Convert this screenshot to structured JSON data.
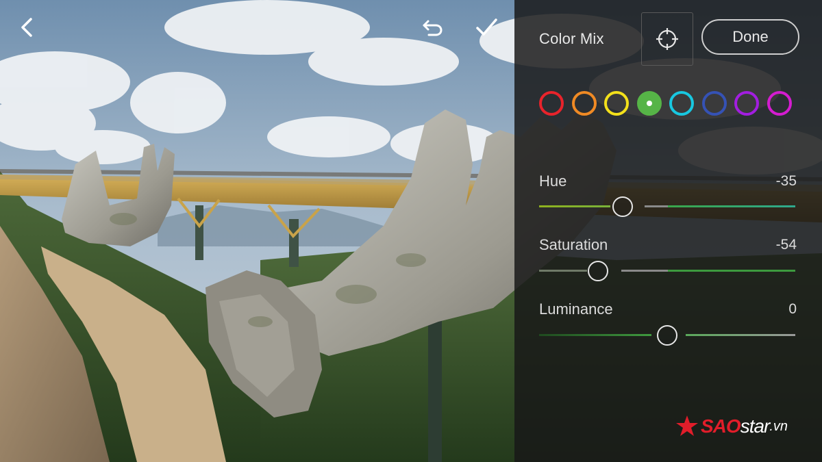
{
  "panel": {
    "title": "Color Mix",
    "done_label": "Done"
  },
  "topbar": {
    "back_icon": "chevron-left-icon",
    "undo_icon": "undo-icon",
    "apply_icon": "checkmark-icon"
  },
  "swatches": [
    {
      "name": "red",
      "color": "#e8232b",
      "selected": false
    },
    {
      "name": "orange",
      "color": "#f08a24",
      "selected": false
    },
    {
      "name": "yellow",
      "color": "#f3e01b",
      "selected": false
    },
    {
      "name": "green",
      "color": "#56b447",
      "selected": true
    },
    {
      "name": "aqua",
      "color": "#18c7e0",
      "selected": false
    },
    {
      "name": "blue",
      "color": "#3552b5",
      "selected": false
    },
    {
      "name": "purple",
      "color": "#a21ee0",
      "selected": false
    },
    {
      "name": "magenta",
      "color": "#d41cd0",
      "selected": false
    }
  ],
  "sliders": [
    {
      "label": "Hue",
      "value": "-35",
      "numeric": -35
    },
    {
      "label": "Saturation",
      "value": "-54",
      "numeric": -54
    },
    {
      "label": "Luminance",
      "value": "0",
      "numeric": 0
    }
  ],
  "watermark": {
    "sao": "SAO",
    "star": "star",
    "vn": ".vn"
  }
}
